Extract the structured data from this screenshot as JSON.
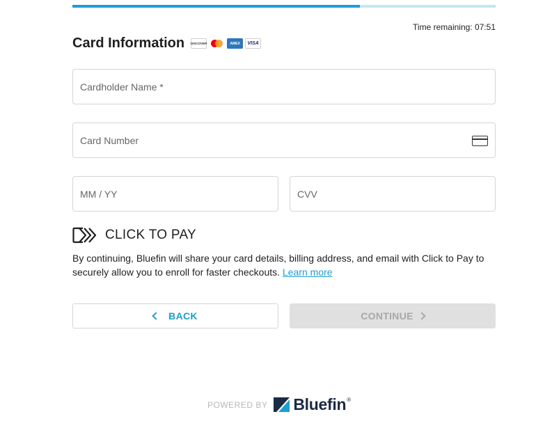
{
  "progress": {
    "fraction": 0.68,
    "track_color": "#c5e6f3",
    "fill_color": "#1b9fd0"
  },
  "timer": {
    "text": "Time remaining: 07:51"
  },
  "header": {
    "title": "Card Information",
    "card_brands": [
      {
        "icon": "discover-logo-icon",
        "text": "DISCOVER"
      },
      {
        "icon": "mastercard-logo-icon"
      },
      {
        "icon": "amex-logo-icon",
        "text": "AMEX"
      },
      {
        "icon": "visa-logo-icon",
        "text": "VISA"
      }
    ]
  },
  "form": {
    "cardholder_name": {
      "placeholder": "Cardholder Name *",
      "value": ""
    },
    "card_number": {
      "placeholder": "Card Number",
      "value": "",
      "icon": "credit-card-icon"
    },
    "expiry": {
      "placeholder": "MM / YY",
      "value": ""
    },
    "cvv": {
      "placeholder": "CVV",
      "value": ""
    }
  },
  "click_to_pay": {
    "icon": "click-to-pay-chevrons-icon",
    "label": "CLICK TO PAY",
    "disclaimer": "By continuing, Bluefin will share your card details, billing address, and email with Click to Pay to securely allow you to enroll for faster checkouts. ",
    "learn_more": "Learn more"
  },
  "buttons": {
    "back": "BACK",
    "continue": "CONTINUE",
    "accent_color": "#1b9fd0"
  },
  "footer": {
    "powered_by": "POWERED BY",
    "brand": "Bluefin",
    "reg_mark": "®"
  }
}
